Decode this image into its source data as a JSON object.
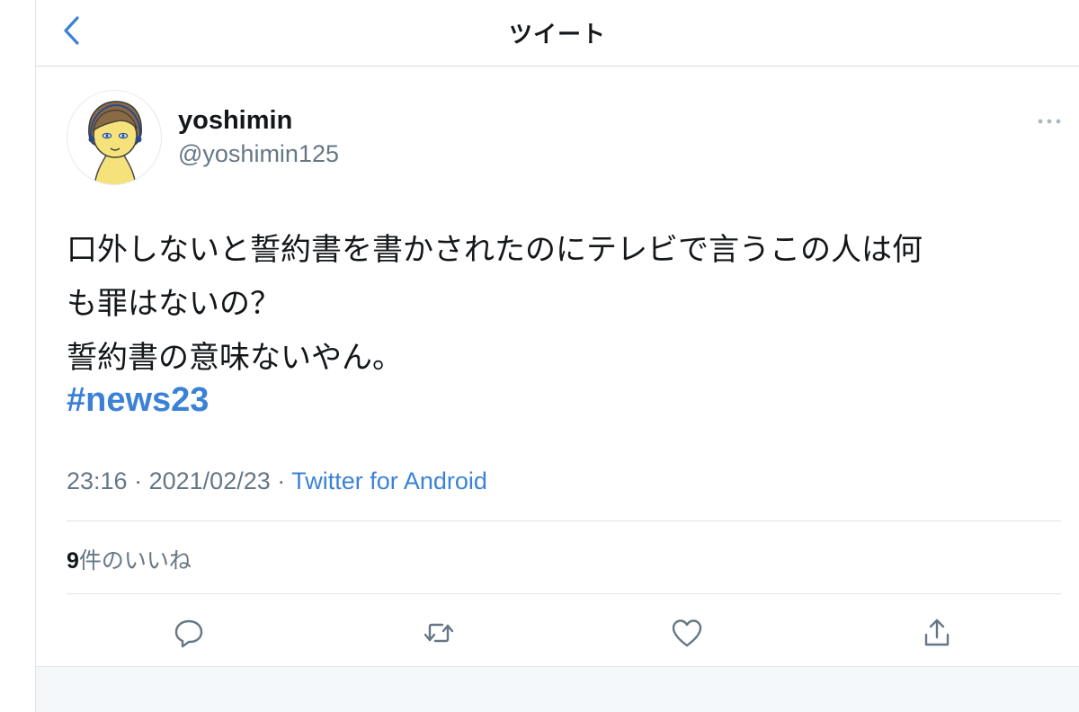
{
  "header": {
    "title": "ツイート",
    "back_icon": "chevron-left-icon"
  },
  "colors": {
    "accent": "#3b82d6",
    "text": "#14171a",
    "secondary": "#657786",
    "divider": "#e1e4e8"
  },
  "tweet": {
    "author": {
      "display_name": "yoshimin",
      "handle": "@yoshimin125",
      "avatar_icon": "cartoon-avatar"
    },
    "text_lines": [
      "口外しないと誓約書を書かされたのにテレビで言うこの人は何",
      "も罪はないの？",
      "誓約書の意味ないやん。"
    ],
    "hashtag": "#news23",
    "time": "23:16",
    "separator": "·",
    "date": "2021/02/23",
    "source": "Twitter for Android",
    "likes_count": "9",
    "likes_label": "件のいいね"
  },
  "actions": [
    {
      "name": "reply",
      "icon": "reply-icon"
    },
    {
      "name": "retweet",
      "icon": "retweet-icon"
    },
    {
      "name": "like",
      "icon": "heart-icon"
    },
    {
      "name": "share",
      "icon": "share-icon"
    }
  ]
}
